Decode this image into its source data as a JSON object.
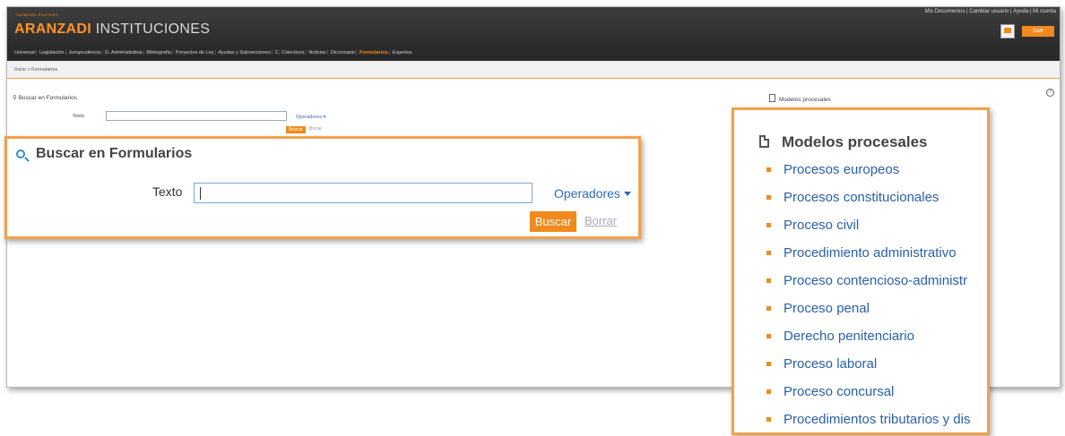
{
  "header": {
    "brand_tag": "THOMSON REUTERS",
    "brand_aranzadi": "ARANZADI",
    "brand_suffix": " INSTITUCIONES",
    "top_links": [
      "Mis Documentos",
      "Cambiar usuario",
      "Ayuda",
      "Mi cuenta"
    ],
    "logout_label": "Salir"
  },
  "nav": {
    "items": [
      "Universal",
      "Legislación",
      "Jurisprudencia",
      "D. Administrativa",
      "Bibliografía",
      "Proyectos de Ley",
      "Ayudas y Subvenciones",
      "C. Colectivos",
      "Noticias",
      "Diccionario",
      "Formularios",
      "Expertos"
    ],
    "active": "Formularios"
  },
  "breadcrumb": "Inicio > Formularios",
  "search": {
    "title": "Buscar en Formularios",
    "field_label": "Texto",
    "operators_label": "Operadores",
    "search_button": "Buscar",
    "clear_button": "Borrar"
  },
  "models": {
    "title": "Modelos procesales",
    "items": [
      "Procesos europeos",
      "Procesos constitucionales",
      "Proceso civil",
      "Procedimiento administrativo",
      "Proceso contencioso-administr",
      "Proceso penal",
      "Derecho penitenciario",
      "Proceso laboral",
      "Proceso concursal",
      "Procedimientos tributarios y dis"
    ]
  },
  "colors": {
    "accent": "#f08a1c",
    "highlight_border": "#f3a14b",
    "link": "#2a5fa8",
    "topbar": "#333333"
  },
  "icons": {
    "search": "magnifier-icon",
    "models": "document-icon",
    "corner": "help-icon",
    "header_doc": "document-icon"
  }
}
